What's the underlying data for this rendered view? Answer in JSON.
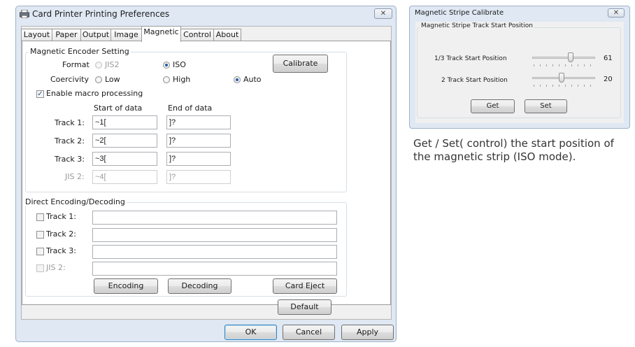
{
  "main_window": {
    "title": "Card Printer Printing Preferences",
    "close_glyph": "✕",
    "tabs": [
      "Layout",
      "Paper",
      "Output",
      "Image",
      "Magnetic",
      "Control",
      "About"
    ],
    "active_tab": "Magnetic",
    "encoder": {
      "legend": "Magnetic Encoder Setting",
      "format_label": "Format",
      "format_options": [
        "JIS2",
        "ISO"
      ],
      "format_selected": "ISO",
      "coercivity_label": "Coercivity",
      "coercivity_options": [
        "Low",
        "High",
        "Auto"
      ],
      "coercivity_selected": "Auto",
      "calibrate_button": "Calibrate",
      "macro_label": "Enable macro processing",
      "macro_checked": true,
      "start_header": "Start of data",
      "end_header": "End of data",
      "tracks": [
        {
          "label": "Track 1:",
          "start": "~1[",
          "end": "]?"
        },
        {
          "label": "Track 2:",
          "start": "~2[",
          "end": "]?"
        },
        {
          "label": "Track 3:",
          "start": "~3[",
          "end": "]?"
        },
        {
          "label": "JIS 2:",
          "start": "~4[",
          "end": "]?",
          "disabled": true
        }
      ]
    },
    "direct": {
      "legend": "Direct Encoding/Decoding",
      "tracks": [
        {
          "label": "Track 1:",
          "value": ""
        },
        {
          "label": "Track 2:",
          "value": ""
        },
        {
          "label": "Track 3:",
          "value": ""
        },
        {
          "label": "JIS 2:",
          "value": "",
          "disabled": true
        }
      ],
      "encoding_button": "Encoding",
      "decoding_button": "Decoding",
      "card_eject_button": "Card Eject"
    },
    "default_button": "Default",
    "ok_button": "OK",
    "cancel_button": "Cancel",
    "apply_button": "Apply"
  },
  "calibrate_window": {
    "title": "Magnetic Stripe Calibrate",
    "close_glyph": "✕",
    "legend": "Magnetic Stripe Track Start Position",
    "sliders": [
      {
        "label": "1/3 Track Start Position",
        "value": "61",
        "level": 0.61
      },
      {
        "label": "2 Track Start Position",
        "value": "20",
        "level": 0.47
      }
    ],
    "get_button": "Get",
    "set_button": "Set"
  },
  "caption": "Get / Set( control) the start position of the magnetic strip (ISO mode)."
}
